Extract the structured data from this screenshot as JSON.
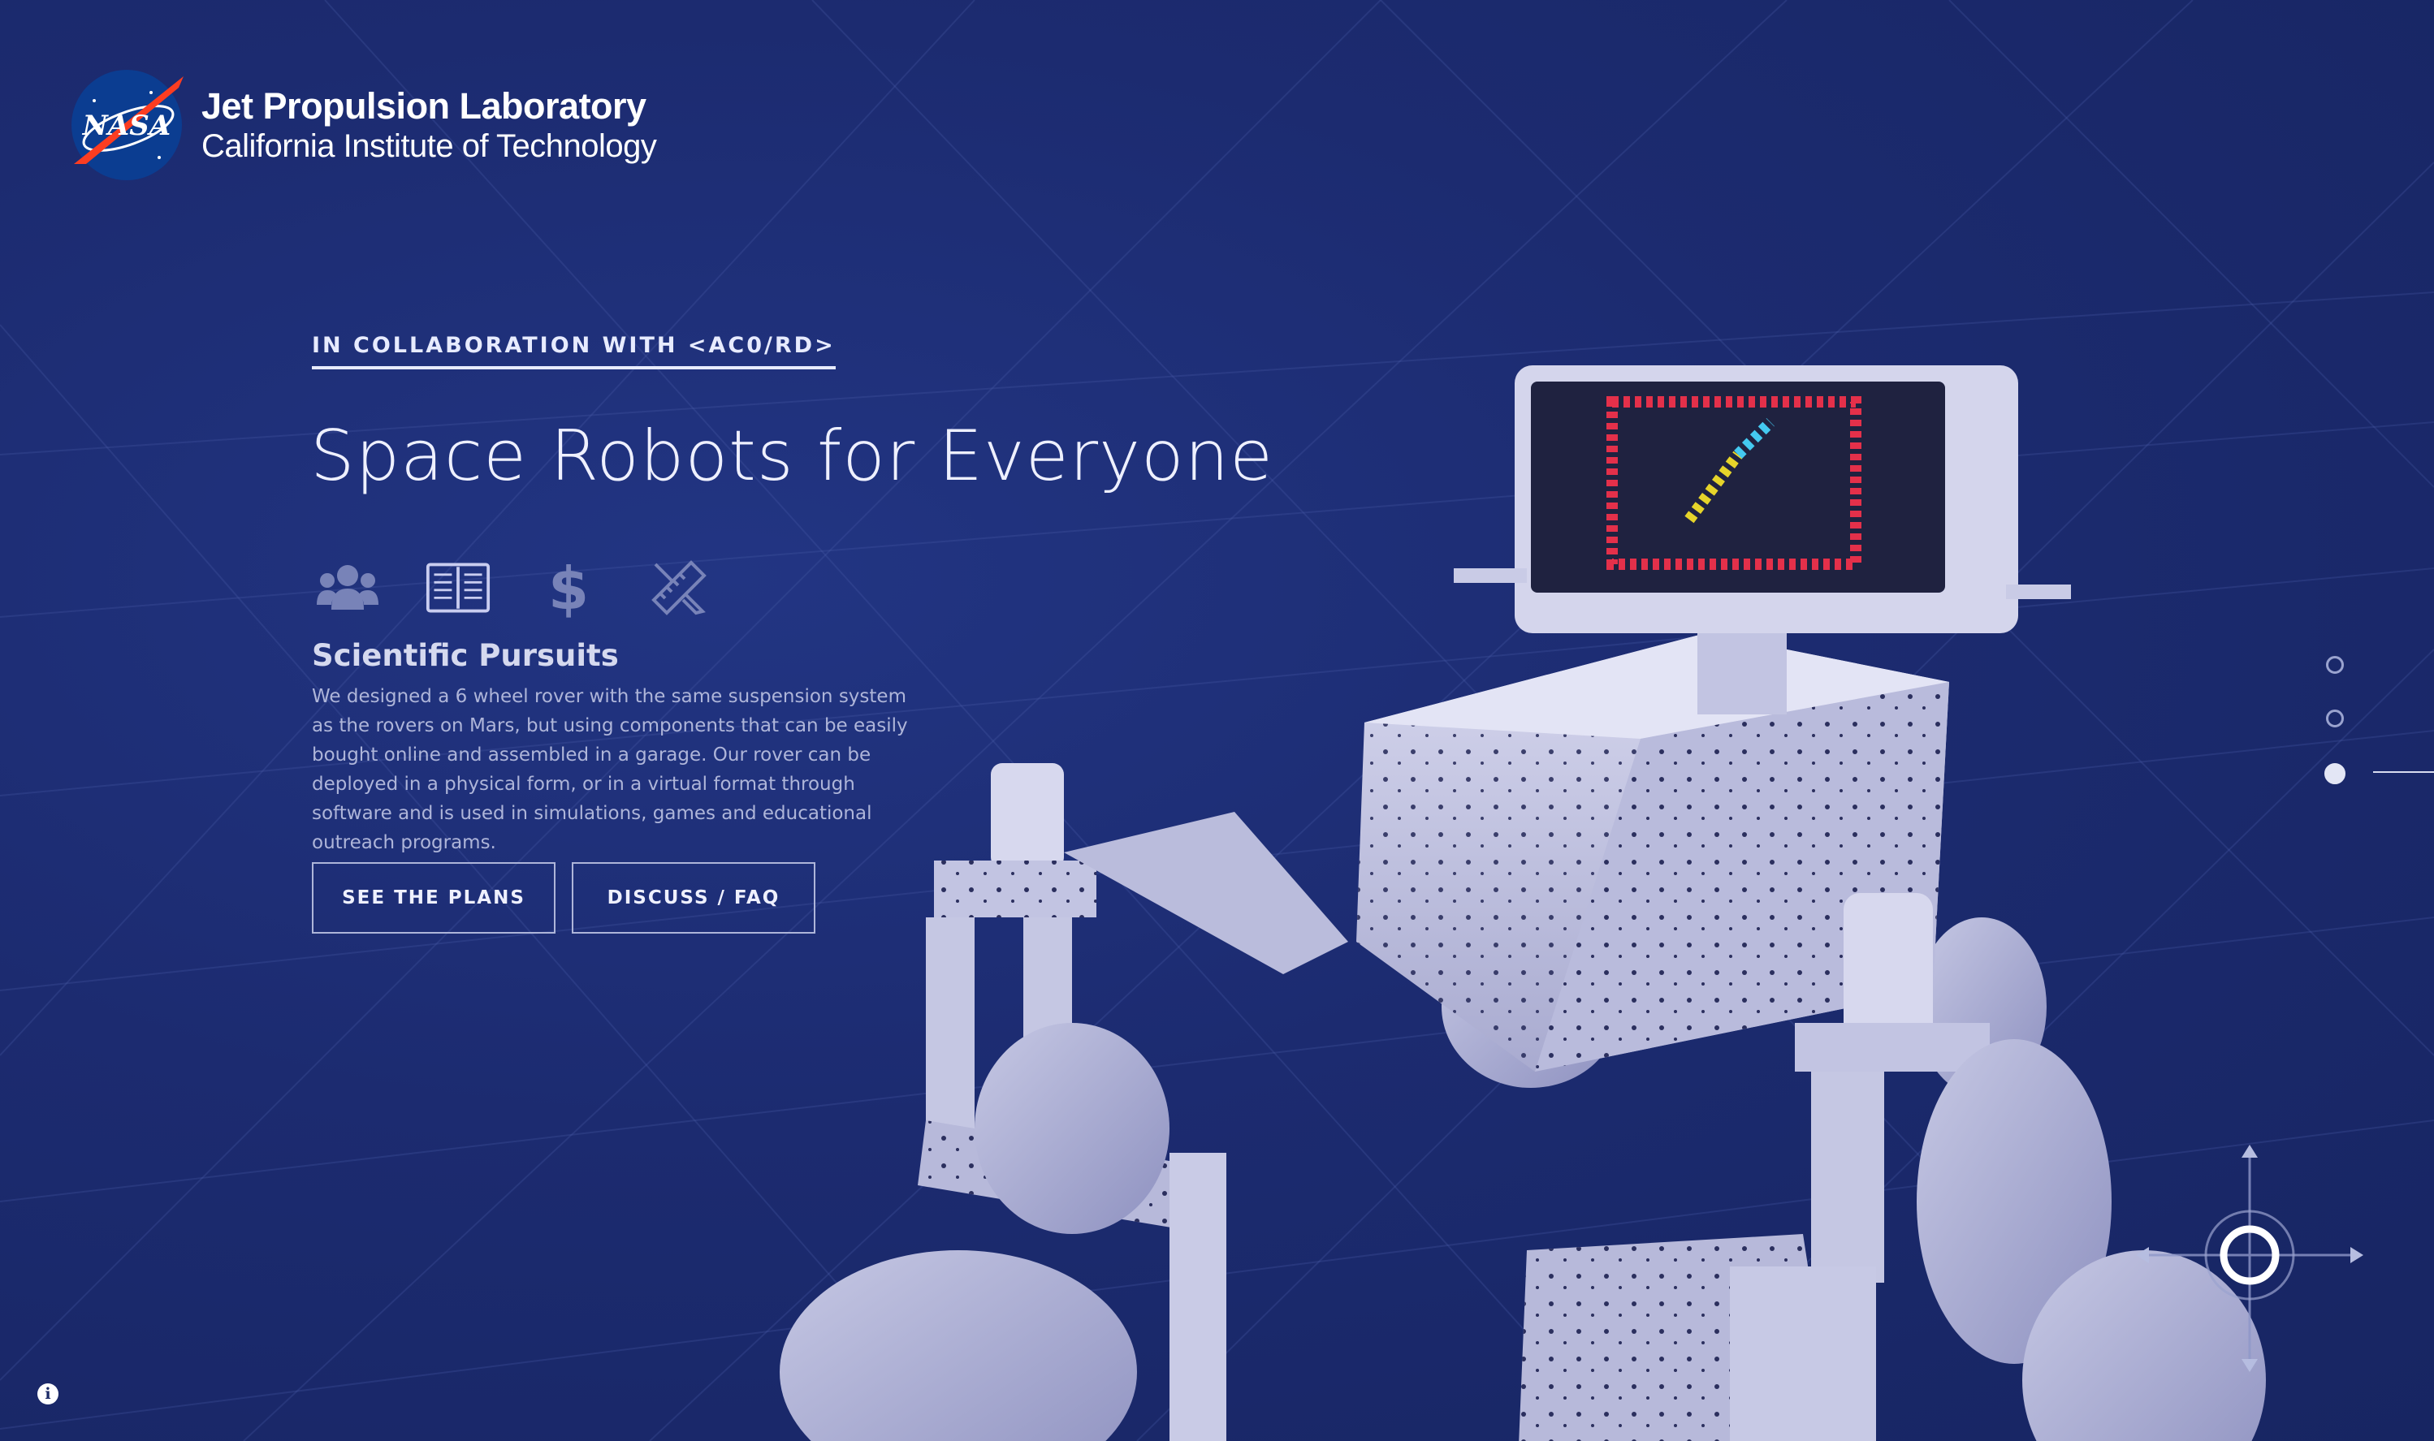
{
  "header": {
    "logo_badge": "NASA",
    "title": "Jet Propulsion Laboratory",
    "subtitle": "California Institute of Technology"
  },
  "hero": {
    "collab_link": "IN COLLABORATION WITH <AC0/RD>",
    "headline": "Space Robots for Everyone",
    "icons": [
      "team-icon",
      "book-icon",
      "dollar-icon",
      "pencil-ruler-icon"
    ],
    "section_title": "Scientific Pursuits",
    "section_body": "We designed a 6 wheel rover with the same suspension system as the rovers on Mars, but using components that can be easily bought online and assembled in a garage. Our rover can be deployed in a physical form, or in a virtual format through software and is used in simulations, games and educational outreach programs.",
    "buttons": {
      "plans": "SEE THE PLANS",
      "faq": "DISCUSS / FAQ"
    }
  },
  "slide_nav": {
    "count": 3,
    "active_index": 2
  },
  "info_icon": "i",
  "colors": {
    "background": "#1b2a66",
    "rover": "#c9cbe6",
    "display_red": "#e4304a",
    "display_yellow": "#e6d42a",
    "display_cyan": "#44c9f0"
  }
}
